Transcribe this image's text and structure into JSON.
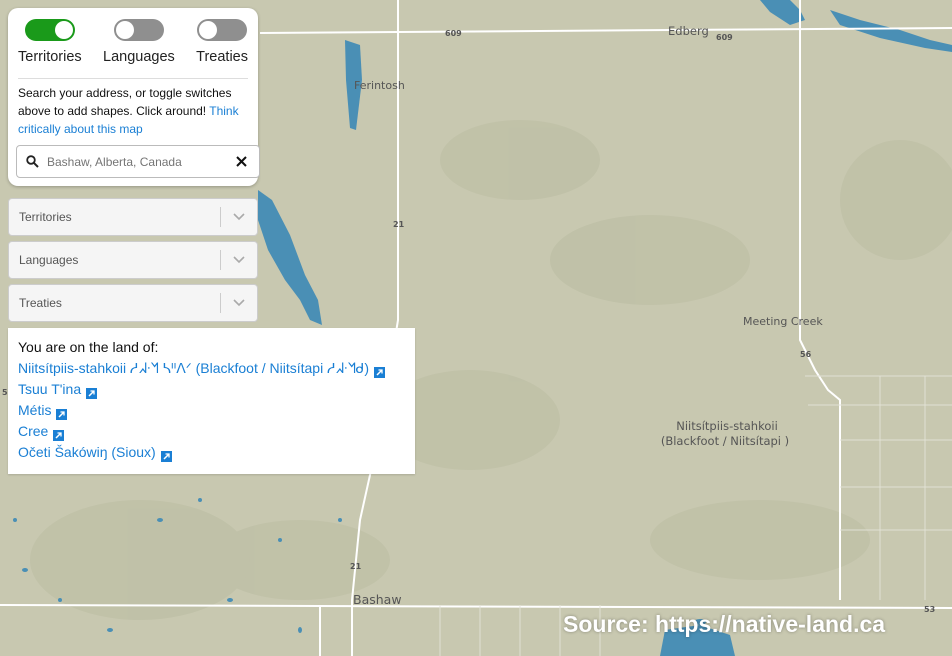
{
  "toggles": [
    {
      "label": "Territories",
      "state": "on"
    },
    {
      "label": "Languages",
      "state": "off"
    },
    {
      "label": "Treaties",
      "state": "off"
    }
  ],
  "help": {
    "text": "Search your address, or toggle switches above to add shapes. Click around!",
    "link": "Think critically about this map"
  },
  "search": {
    "placeholder": "Bashaw, Alberta, Canada"
  },
  "dropdowns": [
    {
      "label": "Territories"
    },
    {
      "label": "Languages"
    },
    {
      "label": "Treaties"
    }
  ],
  "land": {
    "title": "You are on the land of:",
    "items": [
      "Niitsítpiis-stahkoii ᓱᖽᐧᖿ ᓴᐦᐱᐟ (Blackfoot / Niitsítapi ᓱᖽᐧᖿᑯ)",
      "Tsuu T'ina",
      "Métis",
      "Cree",
      "Očeti Šakówiŋ (Sioux)"
    ]
  },
  "map": {
    "places": [
      "Ferintosh",
      "Edberg",
      "Meeting Creek",
      "Bashaw"
    ],
    "territory_label_1": "Niitsítpiis-stahkoii",
    "territory_label_2": "(Blackfoot / Niitsítapi )",
    "road_numbers": [
      "609",
      "609",
      "21",
      "56",
      "21",
      "53",
      "5"
    ],
    "colors": {
      "land": "#c8c8b0",
      "water": "#4a8fb5",
      "roads": "#ffffff"
    }
  },
  "source": "Source: https://native-land.ca"
}
